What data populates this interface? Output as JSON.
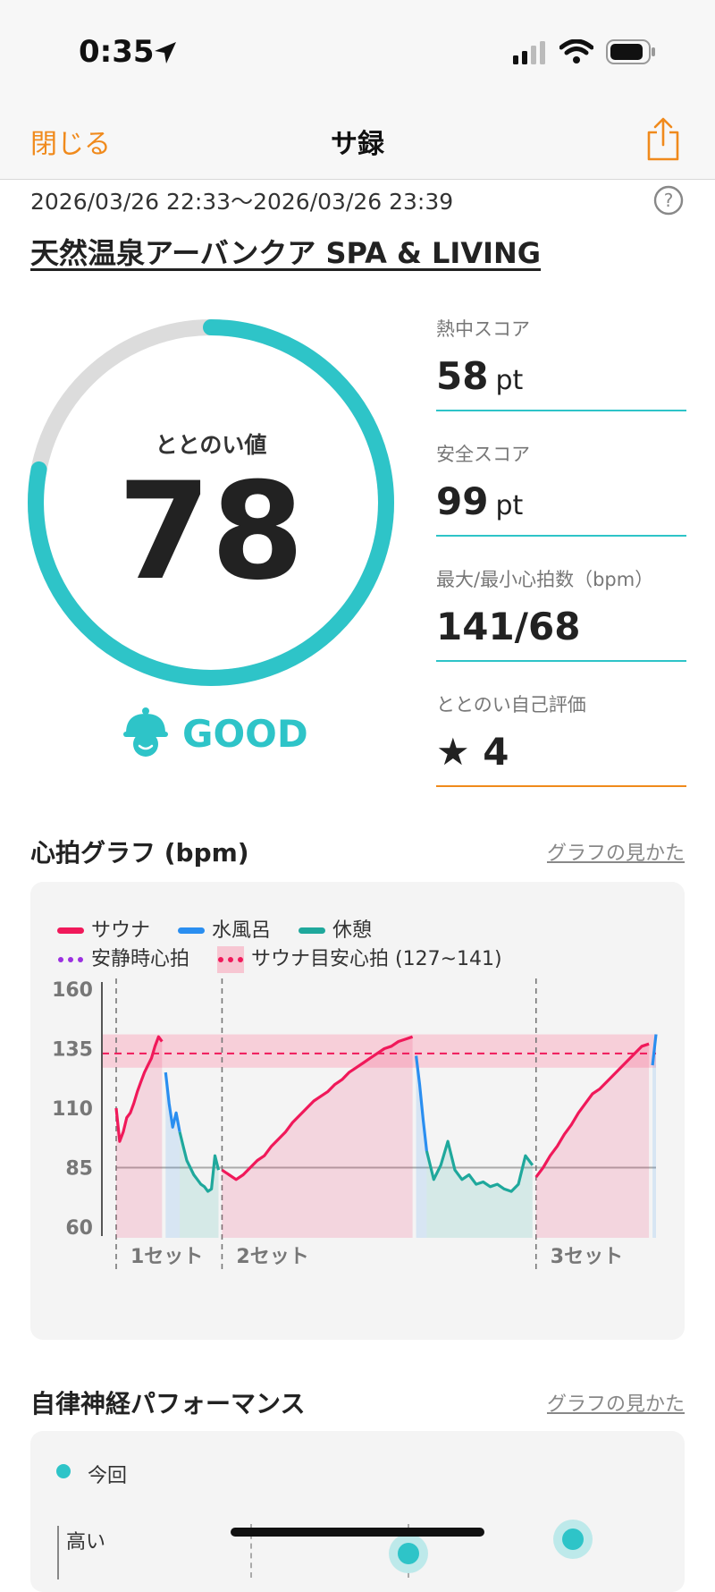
{
  "status_bar": {
    "time": "0:35"
  },
  "nav": {
    "close_label": "閉じる",
    "title": "サ録"
  },
  "session": {
    "datetime": "2026/03/26 22:33～2026/03/26 23:39",
    "venue": "天然温泉アーバンクア SPA & LIVING"
  },
  "score": {
    "label": "ととのい値",
    "value": "78",
    "fraction": 0.78,
    "rating": "GOOD"
  },
  "stats": [
    {
      "label": "熱中スコア",
      "value": "58",
      "unit": "pt"
    },
    {
      "label": "安全スコア",
      "value": "99",
      "unit": "pt"
    },
    {
      "label": "最大/最小心拍数（bpm）",
      "value": "141/68",
      "unit": ""
    },
    {
      "label": "ととのい自己評価",
      "value": "★ 4",
      "unit": ""
    }
  ],
  "heart_section": {
    "title": "心拍グラフ (bpm)",
    "howto_label": "グラフの見かた"
  },
  "legend": {
    "sauna": "サウナ",
    "cold_bath": "水風呂",
    "rest": "休憩",
    "resting_hr": "安静時心拍",
    "target_hr": "サウナ目安心拍 (127~141)"
  },
  "colors": {
    "sauna": "#f0195a",
    "cold_bath": "#2a8ef0",
    "rest": "#1fa89c",
    "resting": "#9b30e0",
    "accent": "#2ec4c8",
    "orange": "#f08a1c"
  },
  "chart_data": {
    "type": "line",
    "ylim": [
      60,
      160
    ],
    "yticks": [
      160,
      135,
      110,
      85,
      60
    ],
    "target_range": [
      127,
      141
    ],
    "resting_hr": 85,
    "set_labels": [
      "1セット",
      "2セット",
      "3セット"
    ],
    "series": [
      {
        "name": "サウナ",
        "color": "#f0195a",
        "x": [
          0,
          1,
          2,
          3,
          4,
          5,
          6,
          7,
          8,
          9,
          10,
          11,
          12,
          13
        ],
        "values": [
          110,
          96,
          100,
          106,
          108,
          112,
          117,
          121,
          125,
          128,
          131,
          136,
          140,
          138
        ]
      },
      {
        "name": "水風呂",
        "color": "#2a8ef0",
        "x": [
          14,
          15,
          16,
          17,
          18
        ],
        "values": [
          125,
          112,
          102,
          108,
          100
        ]
      },
      {
        "name": "休憩",
        "color": "#1fa89c",
        "x": [
          18,
          19,
          20,
          21,
          22,
          23,
          24,
          25,
          26,
          27,
          28,
          29
        ],
        "values": [
          100,
          94,
          88,
          85,
          82,
          80,
          78,
          77,
          75,
          76,
          90,
          84
        ]
      },
      {
        "name": "サウナ",
        "color": "#f0195a",
        "x": [
          30,
          32,
          34,
          36,
          38,
          40,
          42,
          44,
          46,
          48,
          50,
          52,
          54,
          56,
          58,
          60,
          62,
          64,
          66,
          68,
          70,
          72,
          74,
          76,
          78,
          80,
          82,
          84
        ],
        "values": [
          84,
          82,
          80,
          82,
          85,
          88,
          90,
          94,
          97,
          100,
          104,
          107,
          110,
          113,
          115,
          117,
          120,
          122,
          125,
          127,
          129,
          131,
          133,
          135,
          136,
          138,
          139,
          140
        ]
      },
      {
        "name": "水風呂",
        "color": "#2a8ef0",
        "x": [
          85,
          86,
          87,
          88
        ],
        "values": [
          132,
          120,
          105,
          92
        ]
      },
      {
        "name": "休憩",
        "color": "#1fa89c",
        "x": [
          88,
          90,
          92,
          94,
          96,
          98,
          100,
          102,
          104,
          106,
          108,
          110,
          112,
          114,
          116,
          118
        ],
        "values": [
          92,
          80,
          86,
          96,
          84,
          80,
          82,
          78,
          79,
          77,
          78,
          76,
          75,
          78,
          90,
          86
        ]
      },
      {
        "name": "サウナ",
        "color": "#f0195a",
        "x": [
          119,
          121,
          123,
          125,
          127,
          129,
          131,
          133,
          135,
          137,
          139,
          141,
          143,
          145,
          147,
          149,
          151
        ],
        "values": [
          81,
          85,
          90,
          94,
          99,
          103,
          108,
          112,
          116,
          118,
          121,
          124,
          127,
          130,
          133,
          136,
          137
        ]
      },
      {
        "name": "水風呂",
        "color": "#2a8ef0",
        "x": [
          152,
          153
        ],
        "values": [
          128,
          141
        ]
      }
    ]
  },
  "autonomic_section": {
    "title": "自律神経パフォーマンス",
    "howto_label": "グラフの見かた",
    "legend_current": "今回",
    "y_high": "高い"
  }
}
